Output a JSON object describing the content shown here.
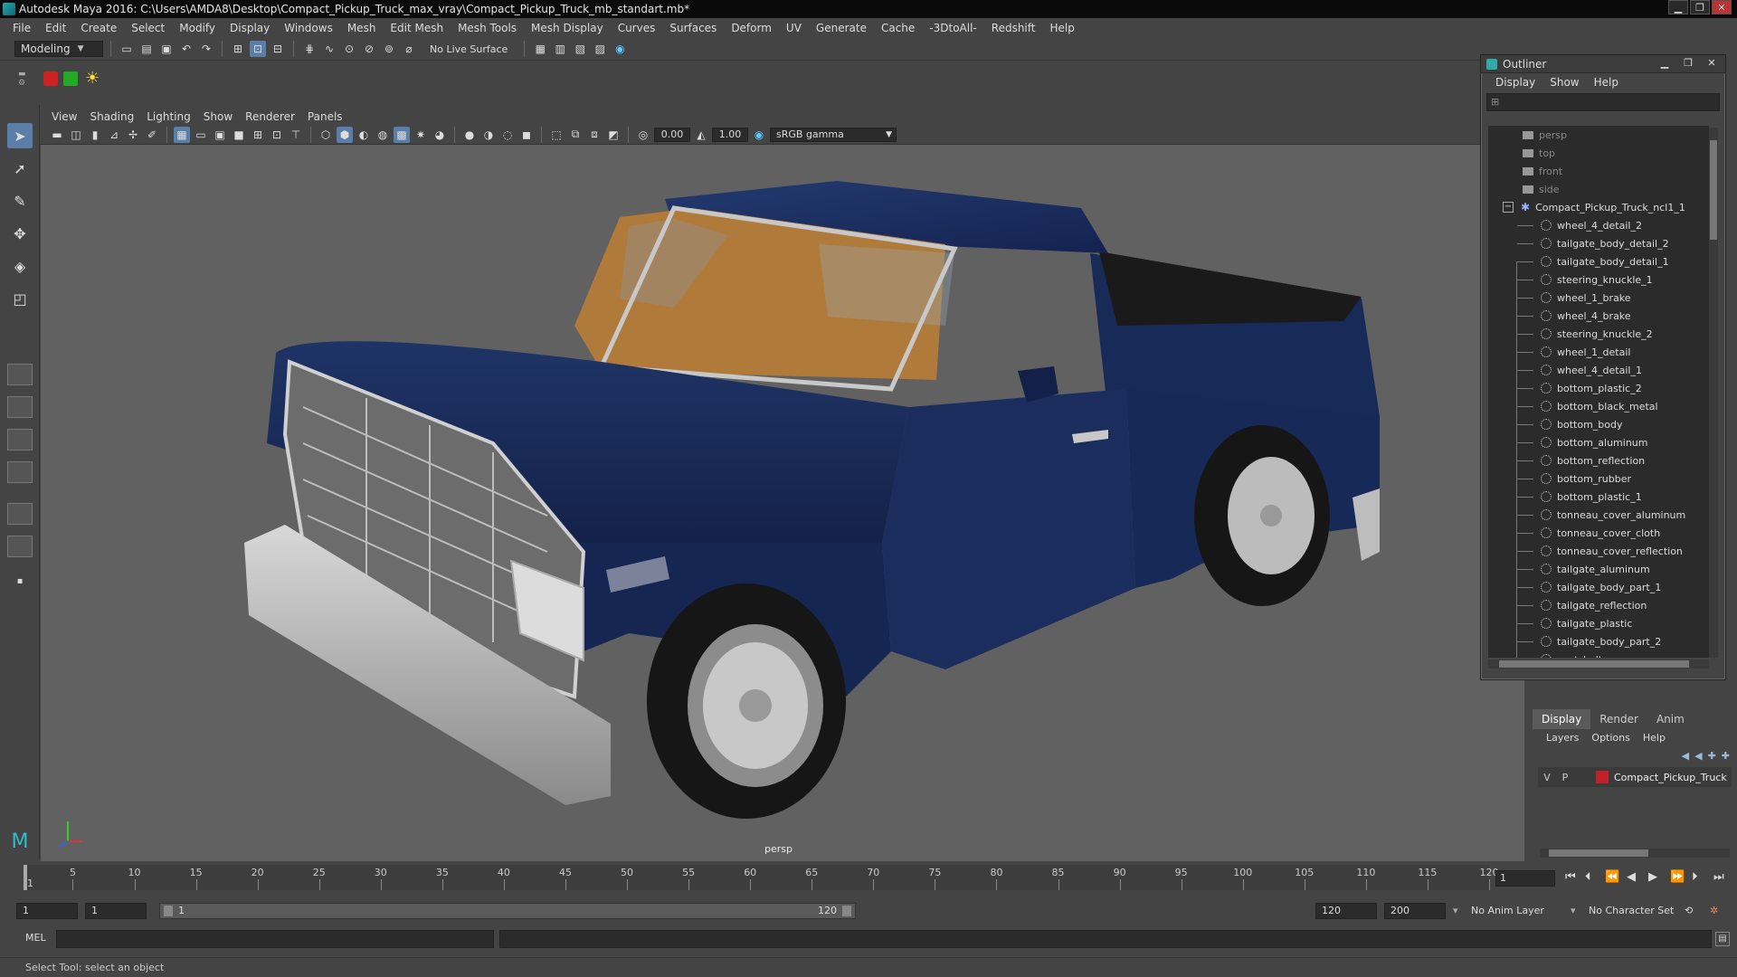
{
  "window": {
    "title": "Autodesk Maya 2016: C:\\Users\\AMDA8\\Desktop\\Compact_Pickup_Truck_max_vray\\Compact_Pickup_Truck_mb_standart.mb*"
  },
  "menubar": [
    "File",
    "Edit",
    "Create",
    "Select",
    "Modify",
    "Display",
    "Windows",
    "Mesh",
    "Edit Mesh",
    "Mesh Tools",
    "Mesh Display",
    "Curves",
    "Surfaces",
    "Deform",
    "UV",
    "Generate",
    "Cache",
    "-3DtoAll-",
    "Redshift",
    "Help"
  ],
  "statusline": {
    "menuset": "Modeling",
    "live_surface": "No Live Surface"
  },
  "panel": {
    "menu": [
      "View",
      "Shading",
      "Lighting",
      "Show",
      "Renderer",
      "Panels"
    ],
    "exposure": "0.00",
    "gamma_value": "1.00",
    "color_space": "sRGB gamma",
    "camera_label": "persp"
  },
  "outliner": {
    "title": "Outliner",
    "menu": [
      "Display",
      "Show",
      "Help"
    ],
    "cameras": [
      "persp",
      "top",
      "front",
      "side"
    ],
    "group": "Compact_Pickup_Truck_ncl1_1",
    "items": [
      "wheel_4_detail_2",
      "tailgate_body_detail_2",
      "tailgate_body_detail_1",
      "steering_knuckle_1",
      "wheel_1_brake",
      "wheel_4_brake",
      "steering_knuckle_2",
      "wheel_1_detail",
      "wheel_4_detail_1",
      "bottom_plastic_2",
      "bottom_black_metal",
      "bottom_body",
      "bottom_aluminum",
      "bottom_reflection",
      "bottom_rubber",
      "bottom_plastic_1",
      "tonneau_cover_aluminum",
      "tonneau_cover_cloth",
      "tonneau_cover_reflection",
      "tailgate_aluminum",
      "tailgate_body_part_1",
      "tailgate_reflection",
      "tailgate_plastic",
      "tailgate_body_part_2",
      "seat_belt"
    ]
  },
  "layer_editor": {
    "tabs": [
      "Display",
      "Render",
      "Anim"
    ],
    "menu": [
      "Layers",
      "Options",
      "Help"
    ],
    "layer": {
      "v": "V",
      "p": "P",
      "name": "Compact_Pickup_Truck",
      "color": "#c0202a"
    }
  },
  "timeline": {
    "ticks": [
      "5",
      "10",
      "15",
      "20",
      "25",
      "30",
      "35",
      "40",
      "45",
      "50",
      "55",
      "60",
      "65",
      "70",
      "75",
      "80",
      "85",
      "90",
      "95",
      "100",
      "105",
      "110",
      "115",
      "120"
    ],
    "start_tick": "1",
    "current_frame": "1"
  },
  "range": {
    "start": "1",
    "start2": "1",
    "inner_start": "1",
    "inner_end": "120",
    "end": "120",
    "end2": "200",
    "anim_layer": "No Anim Layer",
    "char_set": "No Character Set"
  },
  "cmdline": {
    "label": "MEL"
  },
  "helpline": {
    "text": "Select Tool: select an object"
  }
}
